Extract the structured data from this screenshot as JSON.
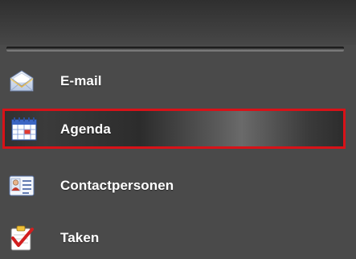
{
  "navigation": {
    "items": [
      {
        "label": "E-mail",
        "icon": "mail-envelope-icon",
        "selected": false
      },
      {
        "label": "Agenda",
        "icon": "calendar-icon",
        "selected": true
      },
      {
        "label": "Contactpersonen",
        "icon": "contact-card-icon",
        "selected": false
      },
      {
        "label": "Taken",
        "icon": "task-clipboard-icon",
        "selected": false
      }
    ]
  },
  "colors": {
    "selection_border": "#d81218",
    "label_text": "#ffffff",
    "panel_background": "#4a4a4a"
  }
}
